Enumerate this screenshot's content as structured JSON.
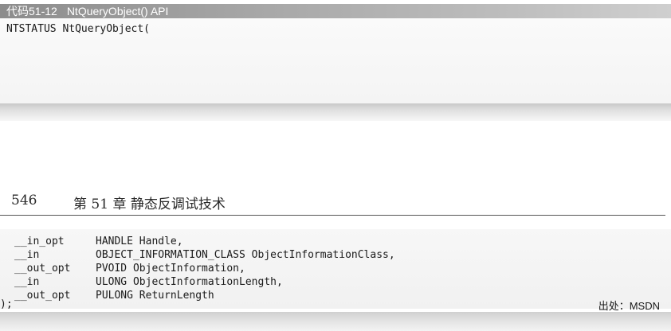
{
  "listing": {
    "label": "代码51-12",
    "title": "NtQueryObject() API",
    "first_line": "NTSTATUS NtQueryObject("
  },
  "page_header": {
    "page_number": "546",
    "chapter": "第 51 章    静态反调试技术"
  },
  "code": {
    "params": [
      {
        "qualifier": "__in_opt",
        "declaration": "HANDLE Handle,"
      },
      {
        "qualifier": "__in",
        "declaration": "OBJECT_INFORMATION_CLASS ObjectInformationClass,"
      },
      {
        "qualifier": "__out_opt",
        "declaration": "PVOID ObjectInformation,"
      },
      {
        "qualifier": "__in",
        "declaration": "ULONG ObjectInformationLength,"
      },
      {
        "qualifier": "__out_opt",
        "declaration": "PULONG ReturnLength"
      }
    ],
    "closing": ");"
  },
  "source_note": "出处：MSDN"
}
